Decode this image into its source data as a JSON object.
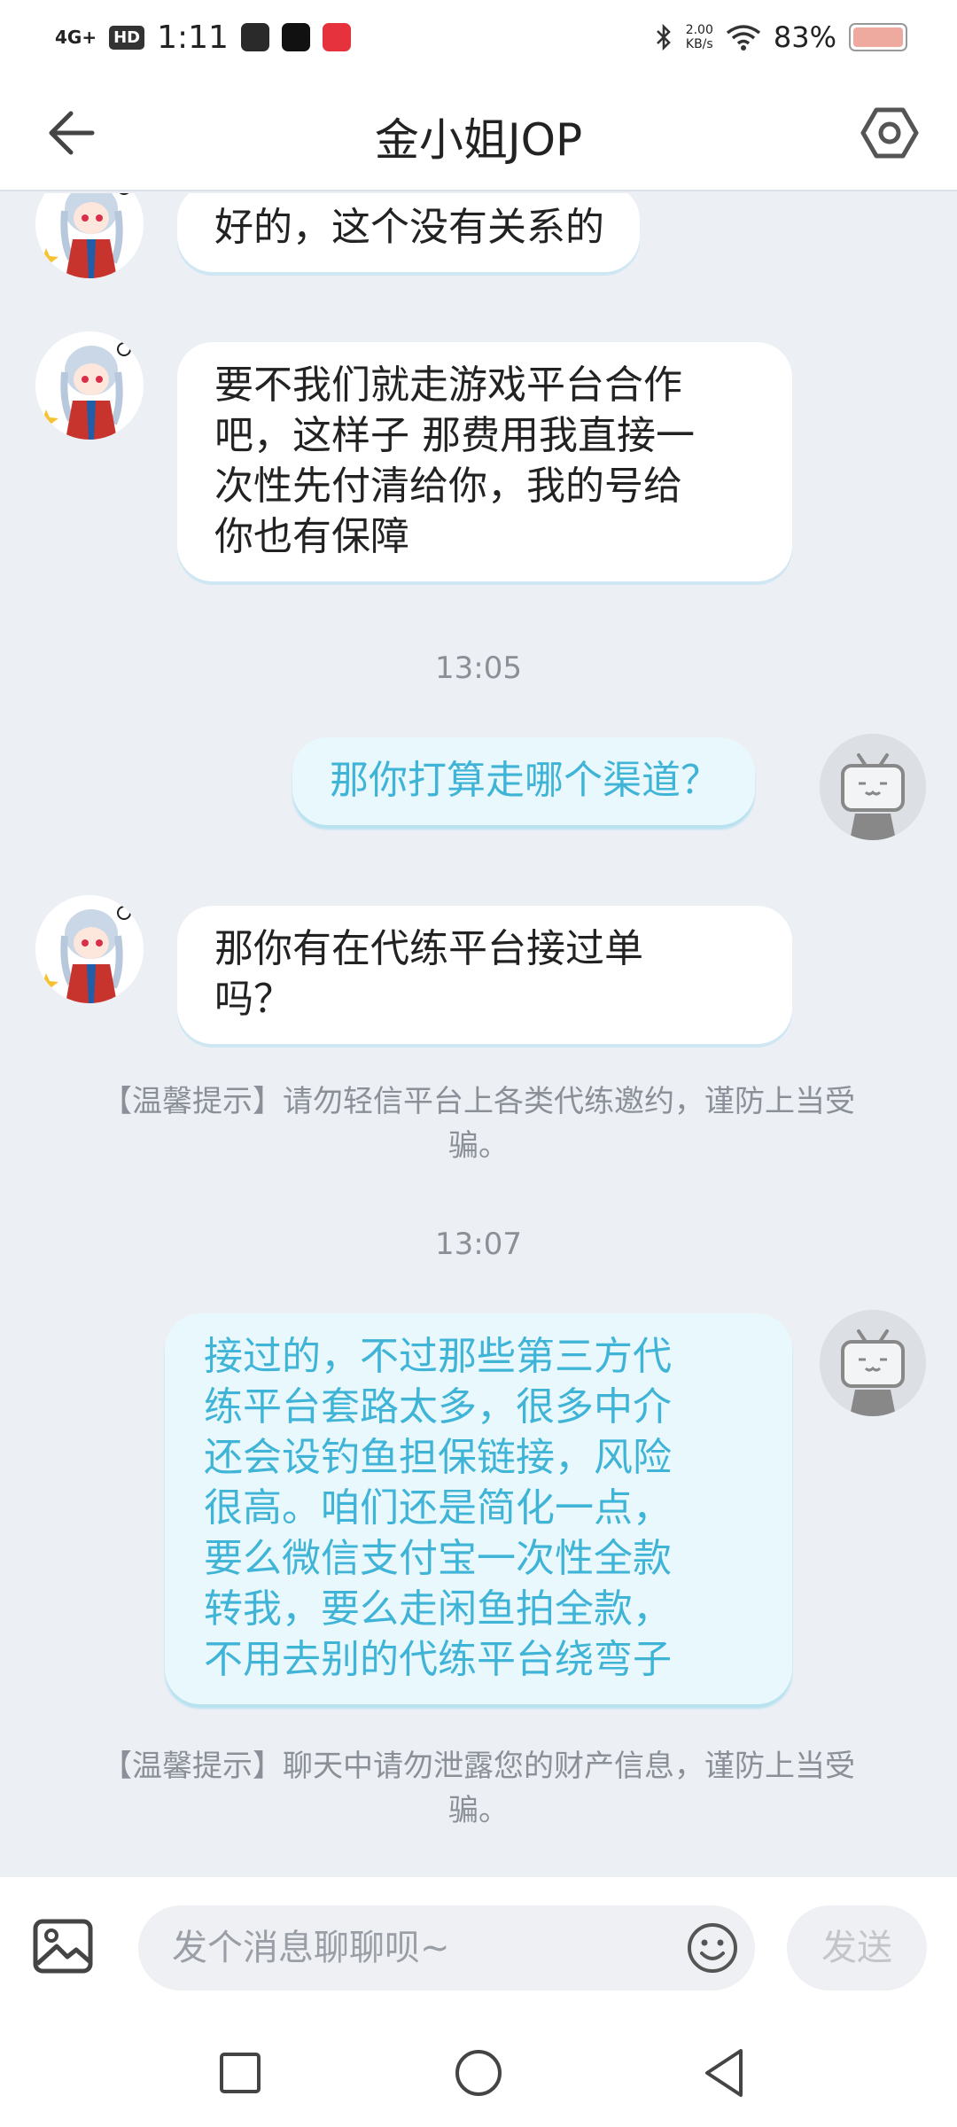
{
  "status_bar": {
    "network": "4G+",
    "hd": "HD",
    "time": "1:11",
    "net_speed_value": "2.00",
    "net_speed_unit": "KB/s",
    "battery": "83%",
    "icons": [
      "tiktok-icon",
      "douyin-icon",
      "red-app-icon",
      "bluetooth-icon",
      "wifi-icon",
      "battery-icon"
    ]
  },
  "header": {
    "title": "金小姐JOP",
    "back_icon": "arrow-left-icon",
    "settings_icon": "settings-hexagon-icon"
  },
  "messages": [
    {
      "dir": "in",
      "lines": [
        "好的，这个没有关系的"
      ]
    },
    {
      "dir": "in",
      "lines": [
        "要不我们就走游戏平台合作",
        "吧，这样子 那费用我直接一",
        "次性先付清给你，我的号给",
        "你也有保障"
      ]
    },
    {
      "timestamp": "13:05"
    },
    {
      "dir": "out",
      "lines": [
        "那你打算走哪个渠道？"
      ]
    },
    {
      "dir": "in",
      "lines": [
        "那你有在代练平台接过单",
        "吗？"
      ]
    },
    {
      "tip_lines": [
        "【温馨提示】请勿轻信平台上各类代练邀约，谨防上当受",
        "骗。"
      ]
    },
    {
      "timestamp": "13:07"
    },
    {
      "dir": "out",
      "lines": [
        "接过的，不过那些第三方代",
        "练平台套路太多，很多中介",
        "还会设钓鱼担保链接，风险",
        "很高。咱们还是简化一点，",
        "要么微信支付宝一次性全款",
        "转我，要么走闲鱼拍全款，",
        "不用去别的代练平台绕弯子"
      ]
    },
    {
      "tip_lines": [
        "【温馨提示】聊天中请勿泄露您的财产信息，谨防上当受",
        "骗。"
      ]
    }
  ],
  "input_bar": {
    "placeholder": "发个消息聊聊呗~",
    "send_label": "发送",
    "image_icon": "image-icon",
    "emoji_icon": "emoji-icon"
  },
  "nav_bar": {
    "icons": [
      "recents-square-icon",
      "home-circle-icon",
      "back-triangle-icon"
    ]
  },
  "colors": {
    "background": "#eceff4",
    "incoming_bubble": "#ffffff",
    "outgoing_bubble": "#e9f8fd",
    "outgoing_text": "#3fb4d6",
    "hint_text": "#8a8f98"
  }
}
